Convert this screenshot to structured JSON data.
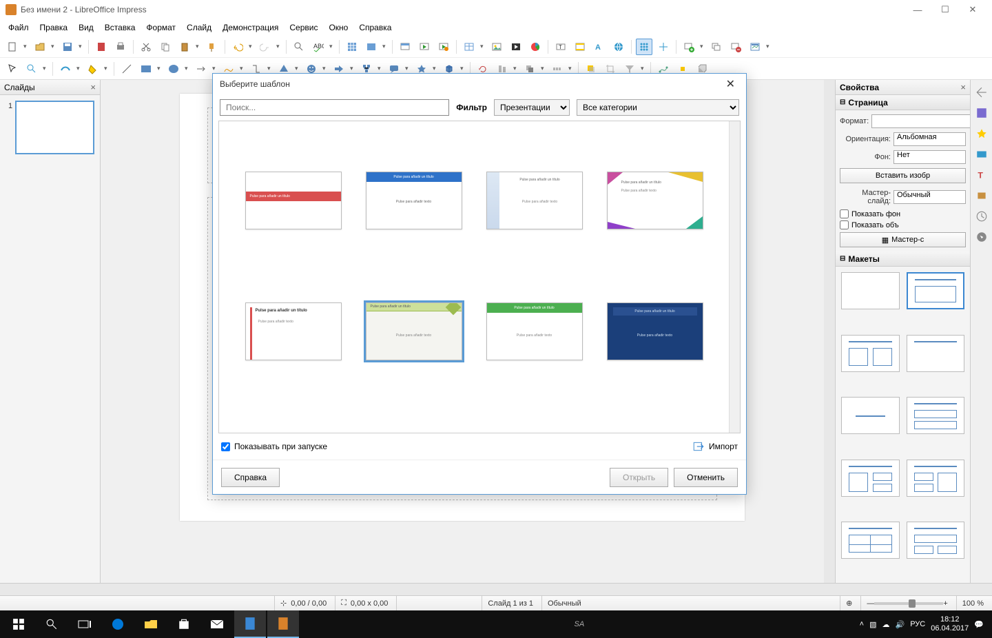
{
  "titlebar": {
    "title": "Без имени 2 - LibreOffice Impress"
  },
  "menu": [
    "Файл",
    "Правка",
    "Вид",
    "Вставка",
    "Формат",
    "Слайд",
    "Демонстрация",
    "Сервис",
    "Окно",
    "Справка"
  ],
  "panes": {
    "slides": {
      "title": "Слайды"
    },
    "props": {
      "title": "Свойства",
      "page_section": "Страница",
      "format_label": "Формат:",
      "format_value": "",
      "orientation_label": "Ориентация:",
      "orientation_value": "Альбомная",
      "background_label": "Фон:",
      "background_value": "Нет",
      "insert_image": "Вставить изобр",
      "master_label": "Мастер-слайд:",
      "master_value": "Обычный",
      "show_bg": "Показать фон",
      "show_obj": "Показать объ",
      "master_btn": "Мастер-с",
      "layouts_section": "Макеты"
    }
  },
  "status": {
    "pos": "0,00 / 0,00",
    "size": "0,00 x 0,00",
    "slide": "Слайд 1 из 1",
    "mode": "Обычный",
    "zoom": "100 %"
  },
  "taskbar": {
    "lang": "РУС",
    "time": "18:12",
    "date": "06.04.2017"
  },
  "dialog": {
    "title": "Выберите шаблон",
    "search_placeholder": "Поиск...",
    "filter_label": "Фильтр",
    "filter_type": "Презентации",
    "filter_cat": "Все категории",
    "show_on_start": "Показывать при запуске",
    "import": "Импорт",
    "help": "Справка",
    "open": "Открыть",
    "cancel": "Отменить",
    "tpl_text": {
      "t1": "Pulse para añadir un título",
      "t2": "Pulse para añadir texto",
      "t3": "Pulse para añadir un título"
    }
  }
}
